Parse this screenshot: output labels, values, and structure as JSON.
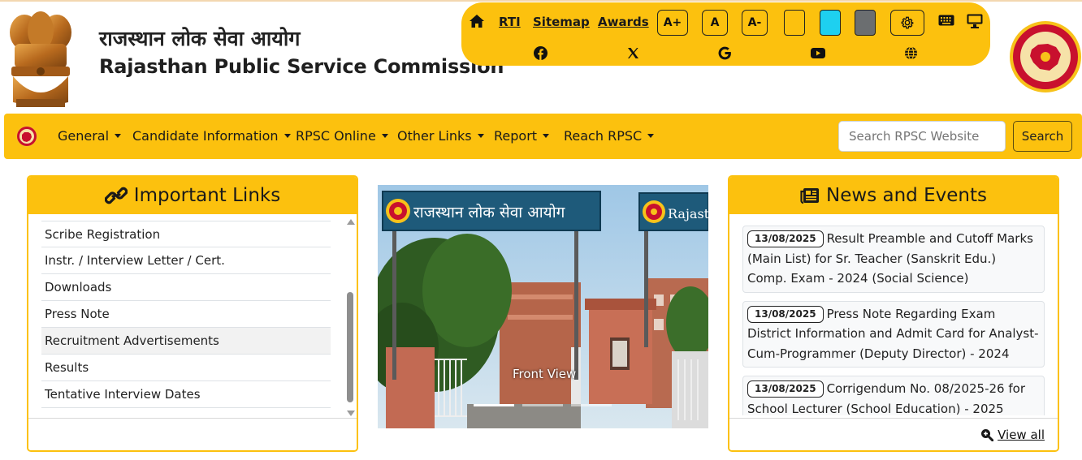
{
  "header": {
    "title_hindi": "राजस्थान लोक सेवा आयोग",
    "title_english": "Rajasthan Public Service Commission"
  },
  "toolbar": {
    "links": [
      "RTI",
      "Sitemap",
      "Awards"
    ],
    "font_buttons": [
      "A+",
      "A",
      "A-"
    ],
    "theme_colors": [
      "#fcc10e",
      "#1ed0f0",
      "#6b6e70"
    ],
    "icons": [
      "home-icon",
      "gear-icon",
      "keyboard-icon",
      "monitor-icon",
      "facebook-icon",
      "x-icon",
      "google-icon",
      "youtube-icon",
      "globe-icon"
    ]
  },
  "nav": {
    "items": [
      "General",
      "Candidate Information",
      "RPSC Online",
      "Other Links",
      "Report",
      "Reach RPSC"
    ],
    "search_placeholder": "Search RPSC Website",
    "search_button": "Search"
  },
  "important_links": {
    "title": "Important Links",
    "items": [
      "Scribe Registration",
      "Instr. / Interview Letter / Cert.",
      "Downloads",
      "Press Note",
      "Recruitment Advertisements",
      "Results",
      "Tentative Interview Dates"
    ]
  },
  "slider": {
    "sign_text": "राजस्थान लोक सेवा आयोग",
    "sign_text_2": "Rajasthan",
    "caption": "Front View"
  },
  "news": {
    "title": "News and Events",
    "items": [
      {
        "date": "13/08/2025",
        "text": "Result Preamble and Cutoff Marks (Main List) for Sr. Teacher (Sanskrit Edu.) Comp. Exam - 2024 (Social Science)"
      },
      {
        "date": "13/08/2025",
        "text": "Press Note Regarding Exam District Information and Admit Card for Analyst-Cum-Programmer (Deputy Director) - 2024"
      },
      {
        "date": "13/08/2025",
        "text": "Corrigendum No. 08/2025-26 for School Lecturer (School Education) - 2025"
      }
    ],
    "view_all": "View all"
  }
}
